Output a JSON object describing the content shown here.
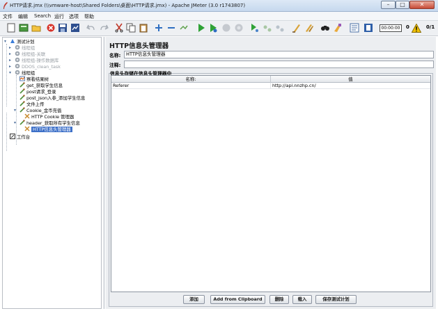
{
  "window": {
    "title": "HTTP请求.jmx (\\\\vmware-host\\Shared Folders\\桌面\\HTTP请求.jmx) - Apache JMeter (3.0 r1743807)",
    "min_glyph": "–",
    "max_glyph": "□",
    "close_glyph": "✕"
  },
  "menu": [
    "文件",
    "编辑",
    "Search",
    "运行",
    "选项",
    "帮助"
  ],
  "toolbar": {
    "icons": [
      "new-icon",
      "templates-icon",
      "open-icon",
      "close-icon",
      "save-icon",
      "save-screenshot-icon",
      "undo-icon",
      "redo-icon",
      "cut-icon",
      "copy-icon",
      "paste-icon",
      "expand-icon",
      "collapse-icon",
      "toggle-icon",
      "start-icon",
      "start-no-pause-icon",
      "stop-icon",
      "shutdown-icon",
      "remote-start-icon",
      "remote-stop-icon",
      "remote-shutdown-icon",
      "clear-icon",
      "clear-all-icon",
      "search-icon",
      "reset-search-icon",
      "function-helper-icon",
      "help-icon"
    ],
    "timer": "00:00:00",
    "error_count": "0",
    "thread_count": "0/1"
  },
  "tree": {
    "items": [
      {
        "label": "测试计划",
        "level": 0,
        "toggle": "▾",
        "icon": "test-plan-icon",
        "state": "normal"
      },
      {
        "label": "线程组",
        "level": 1,
        "toggle": "▸",
        "icon": "thread-group-icon",
        "state": "disabled"
      },
      {
        "label": "线程组-关联",
        "level": 1,
        "toggle": "▸",
        "icon": "thread-group-icon",
        "state": "disabled"
      },
      {
        "label": "线程组-操作数据库",
        "level": 1,
        "toggle": "▸",
        "icon": "thread-group-icon",
        "state": "disabled"
      },
      {
        "label": "DDOS_clean_task",
        "level": 1,
        "toggle": "▸",
        "icon": "thread-group-icon",
        "state": "disabled"
      },
      {
        "label": "线程组",
        "level": 1,
        "toggle": "▾",
        "icon": "thread-group-icon",
        "state": "normal"
      },
      {
        "label": "察看结果树",
        "level": 2,
        "toggle": "",
        "icon": "listener-icon",
        "state": "normal"
      },
      {
        "label": "get_获取学生信息",
        "level": 2,
        "toggle": "",
        "icon": "sampler-icon",
        "state": "normal"
      },
      {
        "label": "post请求_登录",
        "level": 2,
        "toggle": "",
        "icon": "sampler-icon",
        "state": "normal"
      },
      {
        "label": "post_json入参_添加学生信息",
        "level": 2,
        "toggle": "",
        "icon": "sampler-icon",
        "state": "normal"
      },
      {
        "label": "文件上传",
        "level": 2,
        "toggle": "",
        "icon": "sampler-icon",
        "state": "normal"
      },
      {
        "label": "Cookie_金币充值",
        "level": 2,
        "toggle": "▾",
        "icon": "sampler-icon",
        "state": "normal"
      },
      {
        "label": "HTTP Cookie 管理器",
        "level": 3,
        "toggle": "",
        "icon": "config-element-icon",
        "state": "normal"
      },
      {
        "label": "header_获取所有学生信息",
        "level": 2,
        "toggle": "▾",
        "icon": "sampler-icon",
        "state": "normal"
      },
      {
        "label": "HTTP信息头管理器",
        "level": 3,
        "toggle": "",
        "icon": "config-element-icon",
        "state": "selected"
      },
      {
        "label": "工作台",
        "level": 0,
        "toggle": "",
        "icon": "workbench-icon",
        "state": "normal"
      }
    ]
  },
  "main": {
    "title": "HTTP信息头管理器",
    "name_label": "名称:",
    "name_value": "HTTP信息头管理器",
    "comment_label": "注释:",
    "comment_value": "",
    "group_title": "信息头存储在信息头管理器中",
    "table": {
      "columns": [
        "名称:",
        "值"
      ],
      "rows": [
        {
          "name": "Referer",
          "value": "http://api.nnzhp.cn/"
        }
      ]
    },
    "buttons": [
      "添加",
      "Add from Clipboard",
      "删除",
      "载入",
      "保存测试计划"
    ]
  }
}
